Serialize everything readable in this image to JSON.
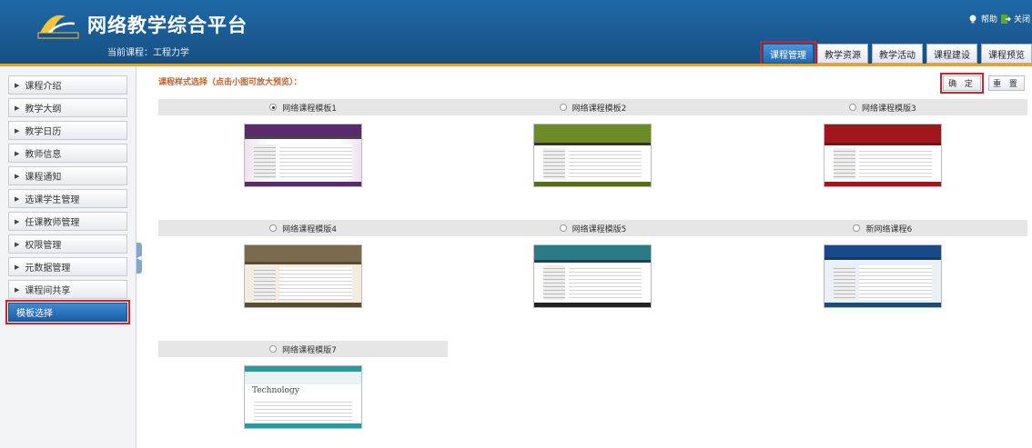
{
  "header": {
    "app_title": "网络教学综合平台",
    "course_label": "当前课程：工程力学",
    "help_label": "帮助",
    "close_label": "关闭"
  },
  "tabs": [
    {
      "label": "课程管理",
      "active": true
    },
    {
      "label": "教学资源",
      "active": false
    },
    {
      "label": "教学活动",
      "active": false
    },
    {
      "label": "课程建设",
      "active": false
    },
    {
      "label": "课程预览",
      "active": false
    }
  ],
  "sidebar": {
    "items": [
      {
        "label": "课程介绍"
      },
      {
        "label": "教学大纲"
      },
      {
        "label": "教学日历"
      },
      {
        "label": "教师信息"
      },
      {
        "label": "课程通知"
      },
      {
        "label": "选课学生管理"
      },
      {
        "label": "任课教师管理"
      },
      {
        "label": "权限管理"
      },
      {
        "label": "元数据管理"
      },
      {
        "label": "课程间共享"
      },
      {
        "label": "模板选择",
        "active": true
      }
    ]
  },
  "main": {
    "instruction": "课程样式选择（点击小图可放大预览）：",
    "confirm_label": "确 定",
    "reset_label": "重 置",
    "templates": [
      {
        "label": "网络课程模板1",
        "selected": true
      },
      {
        "label": "网络课程模板2",
        "selected": false
      },
      {
        "label": "网络课程模版3",
        "selected": false
      },
      {
        "label": "网络课程模版4",
        "selected": false
      },
      {
        "label": "网络课程模版5",
        "selected": false
      },
      {
        "label": "新网络课程6",
        "selected": false
      },
      {
        "label": "网络课程模版7",
        "selected": false
      }
    ],
    "thumb7_text": "Technology"
  },
  "colors": {
    "header_blue": "#1a5a92",
    "active_tab": "#1d6ab6",
    "highlight_red": "#c8262d",
    "instruction_orange": "#c0602a"
  },
  "icons": {
    "logo": "platform-logo",
    "help": "lightbulb-icon",
    "close": "exit-icon",
    "sidebar_arrow": "triangle-right-icon",
    "radio": "radio-button"
  }
}
